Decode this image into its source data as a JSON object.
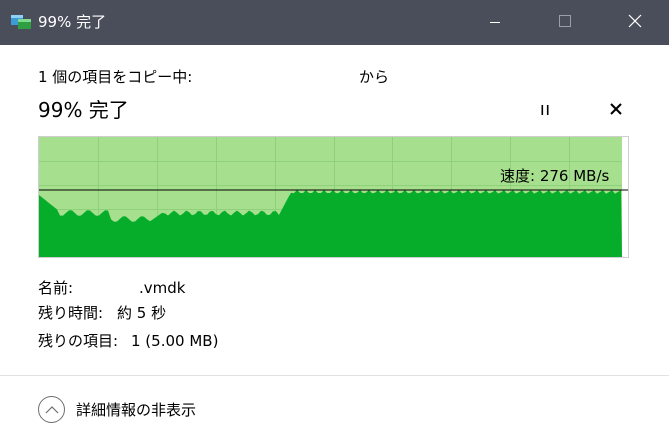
{
  "window": {
    "title": "99% 完了",
    "minimize_icon": "minimize-icon",
    "maximize_icon": "maximize-icon",
    "close_icon": "close-icon"
  },
  "copy": {
    "line_prefix": "1 個の項目をコピー中:",
    "line_suffix": "から",
    "percent_text": "99% 完了"
  },
  "controls": {
    "pause_icon": "pause-icon",
    "cancel_icon": "cancel-icon"
  },
  "graph": {
    "speed_text": "速度: 276 MB/s",
    "progress_fraction": 0.99,
    "colors": {
      "filled_background": "#a6e08e",
      "throughput": "#06ad2a",
      "empty_background": "#ffffff",
      "speed_line": "#000000"
    }
  },
  "info": {
    "name_label": "名前:",
    "name_value": ".vmdk",
    "time_label": "残り時間:",
    "time_value": "約 5 秒",
    "items_label": "残りの項目:",
    "items_value": "1 (5.00 MB)"
  },
  "footer": {
    "details_label": "詳細情報の非表示",
    "toggle_icon": "chevron-up-icon"
  }
}
